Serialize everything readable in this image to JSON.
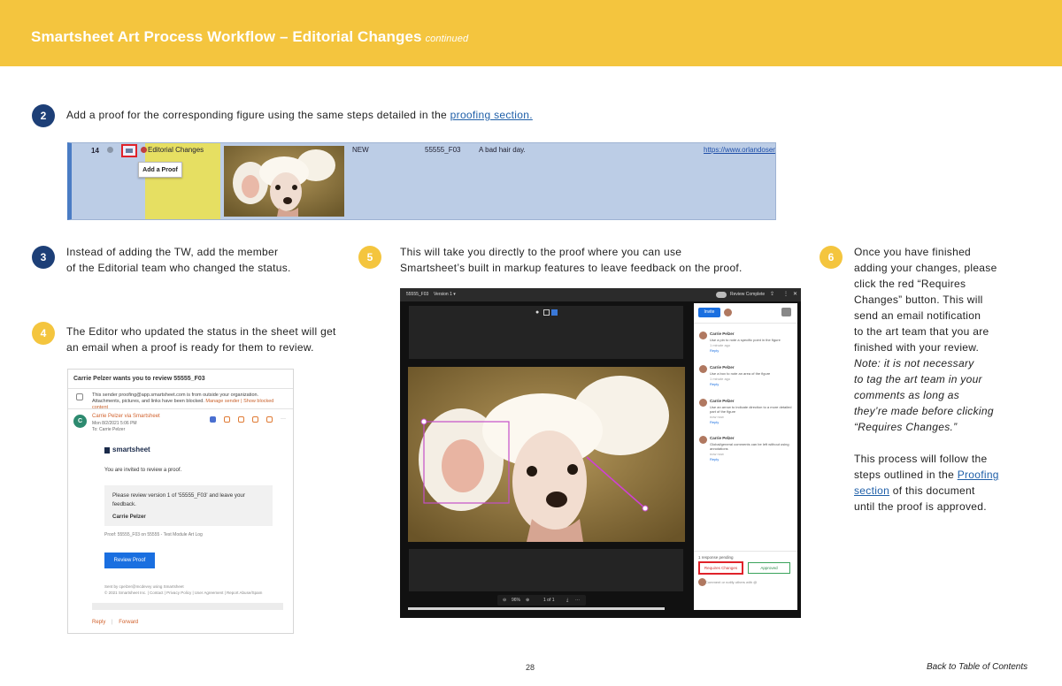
{
  "header": {
    "title": "Smartsheet Art Process Workflow – Editorial Changes",
    "subtitle": "continued",
    "color": "#f4c53e"
  },
  "steps": {
    "s2": {
      "number": "2",
      "text": "Add a proof for the corresponding figure using the same steps detailed in the",
      "link": "proofing section."
    },
    "s3": {
      "number": "3",
      "line1": "Instead of adding the TW, add the member",
      "line2": "of the Editorial team who changed the status."
    },
    "s4": {
      "number": "4",
      "line1": "The Editor who updated the status in the sheet will get",
      "line2": "an email when a proof is ready for them to review."
    },
    "s5": {
      "number": "5",
      "line1": "This will take you directly to the proof where you can use",
      "line2": "Smartsheet’s built in markup features to leave feedback on the proof."
    },
    "s6": {
      "number": "6",
      "lines": [
        "Once you have finished",
        "adding your changes, please",
        "click the red “Requires",
        "Changes” button. This will",
        "send an email notification",
        "to the art team that you are",
        "finished with your review."
      ],
      "note_lines": [
        "Note: it is not necessary",
        "to tag the art team in your",
        "comments as long as",
        "they’re made before clicking",
        "“Requires Changes.”"
      ],
      "tail_line1": "This process will follow the",
      "tail_line2_pre": "steps outlined in the",
      "tail_link1": "Proofing",
      "tail_link2": "section",
      "tail_line3_post": "of this document",
      "tail_line4": "until the proof is approved."
    }
  },
  "sheet_row": {
    "row_number": "14",
    "status": "Editorial Changes",
    "tooltip": "Add a Proof",
    "state": "NEW",
    "figure_id": "55555_F03",
    "caption": "A bad hair day.",
    "url": "https://www.orlandosen"
  },
  "email": {
    "subject": "Carrie Pelzer wants you to review 55555_F03",
    "warning": "This sender proofing@app.smartsheet.com is from outside your organization. Attachments, pictures, and links have been blocked.",
    "warning_links": "Manage sender | Show blocked content",
    "avatar_letter": "C",
    "sender": "Carrie Pelzer via Smartsheet",
    "date": "Mon 8/2/2021 5:06 PM",
    "to": "To: Carrie Pelzer",
    "logo": "smartsheet",
    "invite": "You are invited to review a proof.",
    "box_text": "Please review version 1 of '55555_F03' and leave your feedback.",
    "box_name": "Carrie Pelzer",
    "proof_line": "Proof: 55555_F03 on 55555 - Test Module Art Log",
    "button": "Review Proof",
    "foot1": "Sent by cpelzer@mcdevvy using Smartsheet",
    "foot2": "© 2021 Smartsheet Inc. | Contact | Privacy Policy | User Agreement | Report Abuse/Spam",
    "reply": "Reply",
    "forward": "Forward"
  },
  "viewer": {
    "file": "55555_F03",
    "version": "Version 1 ▾",
    "review_status": "Review Complete",
    "zoom": "96%",
    "page": "1 of 1",
    "invite": "Invite",
    "comments": [
      {
        "name": "Carrie Pelzer",
        "text": "Use a pin to note a specific point in the figure",
        "time": "1 minute ago",
        "reply": "Reply"
      },
      {
        "name": "Carrie Pelzer",
        "text": "Use a box to note an area of the figure",
        "time": "1 minute ago",
        "reply": "Reply"
      },
      {
        "name": "Carrie Pelzer",
        "text": "Use an arrow to indicate direction to a more detailed part of the figure",
        "time": "now now",
        "reply": "Reply"
      },
      {
        "name": "Carrie Pelzer",
        "text": "Global/general comments can be left without using annotations",
        "time": "now now",
        "reply": "Reply"
      }
    ],
    "pending": "1 response pending",
    "requires_changes": "Requires Changes",
    "approved": "Approved",
    "input_placeholder": "Comment or notify others with @"
  },
  "footer": {
    "page": "28",
    "back": "Back to Table of Contents"
  }
}
